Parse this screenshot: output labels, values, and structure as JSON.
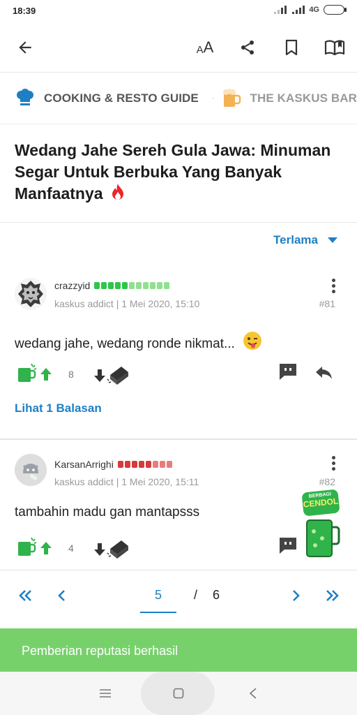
{
  "status_bar": {
    "time": "18:39",
    "network": "4G"
  },
  "toolbar": {
    "text_size_label_small": "A",
    "text_size_label_large": "A"
  },
  "breadcrumb": [
    {
      "label": "COOKING & RESTO GUIDE",
      "icon": "chef-hat-icon"
    },
    {
      "label": "THE KASKUS BAR",
      "icon": "beer-mug-icon"
    }
  ],
  "thread": {
    "title": "Wedang Jahe Sereh Gula Jawa: Minuman Segar Untuk Berbuka Yang Banyak Manfaatnya",
    "hot_icon": "fire-icon"
  },
  "sort": {
    "label": "Terlama"
  },
  "posts": [
    {
      "username": "crazzyid",
      "rank": "kaskus addict",
      "date": "1 Mei 2020, 15:10",
      "number": "#81",
      "body": "wedang jahe, wedang ronde nikmat...",
      "emoji": "wink-tongue-emoji-icon",
      "cendol_count": "8",
      "rep_color": "#2fc54a",
      "replies_link": "Lihat 1 Balasan"
    },
    {
      "username": "KarsanArrighi",
      "rank": "kaskus addict",
      "date": "1 Mei 2020, 15:11",
      "number": "#82",
      "body": "tambahin madu gan mantapsss",
      "cendol_count": "4",
      "rep_color": "#d63a3a",
      "sticker_text_top": "BERBAGI",
      "sticker_text_bottom": "CENDOL"
    }
  ],
  "pagination": {
    "current": "5",
    "separator": "/",
    "total": "6"
  },
  "toast": {
    "message": "Pemberian reputasi berhasil"
  },
  "colors": {
    "accent": "#1e7fc4",
    "success": "#77d16b",
    "cendol_green": "#2fb34a"
  }
}
